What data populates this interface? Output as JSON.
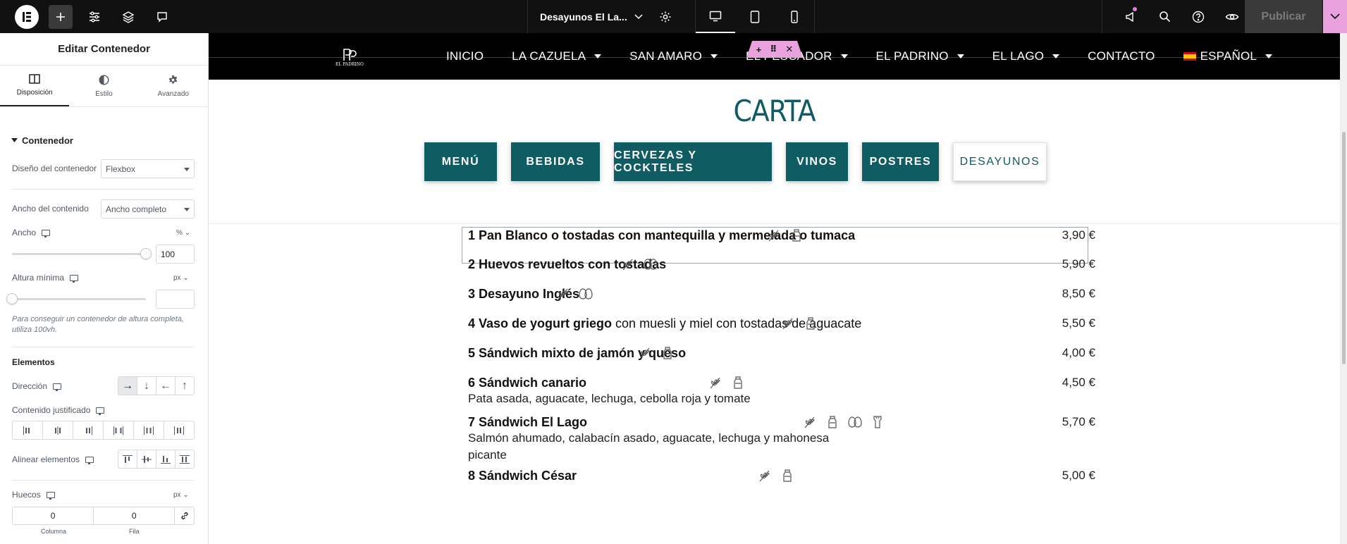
{
  "topbar": {
    "doc_title": "Desayunos El La...",
    "publish_label": "Publicar",
    "colors": {
      "bg": "#111111",
      "accent": "#e9a2dd"
    }
  },
  "panel": {
    "title": "Editar Contenedor",
    "tabs": [
      {
        "label": "Disposición",
        "icon": "layout-icon"
      },
      {
        "label": "Estilo",
        "icon": "style-icon"
      },
      {
        "label": "Avanzado",
        "icon": "gear-icon"
      }
    ],
    "section": "Contenedor",
    "container_design": {
      "label": "Diseño del contenedor",
      "value": "Flexbox"
    },
    "content_width": {
      "label": "Ancho del contenido",
      "value": "Ancho completo"
    },
    "width": {
      "label": "Ancho",
      "unit": "%",
      "value": "100",
      "slider_fraction": 1.0
    },
    "min_height": {
      "label": "Altura mínima",
      "unit": "px",
      "value": "",
      "slider_fraction": 0
    },
    "hint": "Para conseguir un contenedor de altura completa, utiliza 100vh.",
    "elements_heading": "Elementos",
    "direction": {
      "label": "Dirección",
      "options": [
        "→",
        "↓",
        "←",
        "↑"
      ],
      "selected": 0
    },
    "justify": {
      "label": "Contenido justificado"
    },
    "align": {
      "label": "Alinear elementos"
    },
    "gaps": {
      "label": "Huecos",
      "unit": "px",
      "column": "0",
      "row": "0",
      "column_label": "Columna",
      "row_label": "Fila"
    }
  },
  "site": {
    "nav": [
      "INICIO",
      "LA CAZUELA",
      "SAN AMARO",
      "EL PESCADOR",
      "EL PADRINO",
      "EL LAGO",
      "CONTACTO",
      "ESPAÑOL"
    ],
    "nav_dropdown": [
      false,
      true,
      true,
      true,
      true,
      true,
      false,
      true
    ],
    "logo_text": "EL PADRINO",
    "heading": "CARTA",
    "categories": [
      "MENÚ",
      "BEBIDAS",
      "CERVEZAS Y COCKTELES",
      "VINOS",
      "POSTRES",
      "DESAYUNOS"
    ],
    "selected_category": "DESAYUNOS",
    "colors": {
      "teal": "#0f5c63",
      "nav_bg": "#000000"
    }
  },
  "menu": [
    {
      "name": "1 Pan Blanco o tostadas con mantequilla y mermelada o tumaca",
      "desc": "",
      "sub": "",
      "price": "3,90 €",
      "icons": [
        "gluten-icon",
        "milk-icon"
      ]
    },
    {
      "name": "2 Huevos revueltos con tostadas",
      "desc": "",
      "sub": "",
      "price": "5,90 €",
      "icons": [
        "gluten-icon",
        "egg-icon"
      ]
    },
    {
      "name": "3 Desayuno Inglés",
      "desc": "",
      "sub": "",
      "price": "8,50 €",
      "icons": [
        "gluten-icon",
        "egg-icon"
      ]
    },
    {
      "name": "4 Vaso de yogurt griego",
      "desc": " con muesli y miel con tostadas de aguacate",
      "sub": "",
      "price": "5,50 €",
      "icons": [
        "gluten-icon",
        "milk-icon"
      ]
    },
    {
      "name": "5 Sándwich mixto de jamón y queso",
      "desc": "",
      "sub": "",
      "price": "4,00 €",
      "icons": [
        "gluten-icon",
        "milk-icon"
      ]
    },
    {
      "name": "6 Sándwich canario",
      "desc": "",
      "sub": "Pata asada, aguacate, lechuga, cebolla roja y tomate",
      "price": "4,50 €",
      "icons": [
        "gluten-icon",
        "milk-icon"
      ]
    },
    {
      "name": "7 Sándwich El Lago",
      "desc": "",
      "sub": "Salmón ahumado, calabacín asado, aguacate, lechuga y mahonesa picante",
      "price": "5,70 €",
      "icons": [
        "gluten-icon",
        "milk-icon",
        "egg-icon",
        "fish-icon"
      ]
    },
    {
      "name": "8 Sándwich César",
      "desc": "",
      "sub": "",
      "price": "5,00 €",
      "icons": [
        "gluten-icon",
        "milk-icon"
      ]
    }
  ]
}
